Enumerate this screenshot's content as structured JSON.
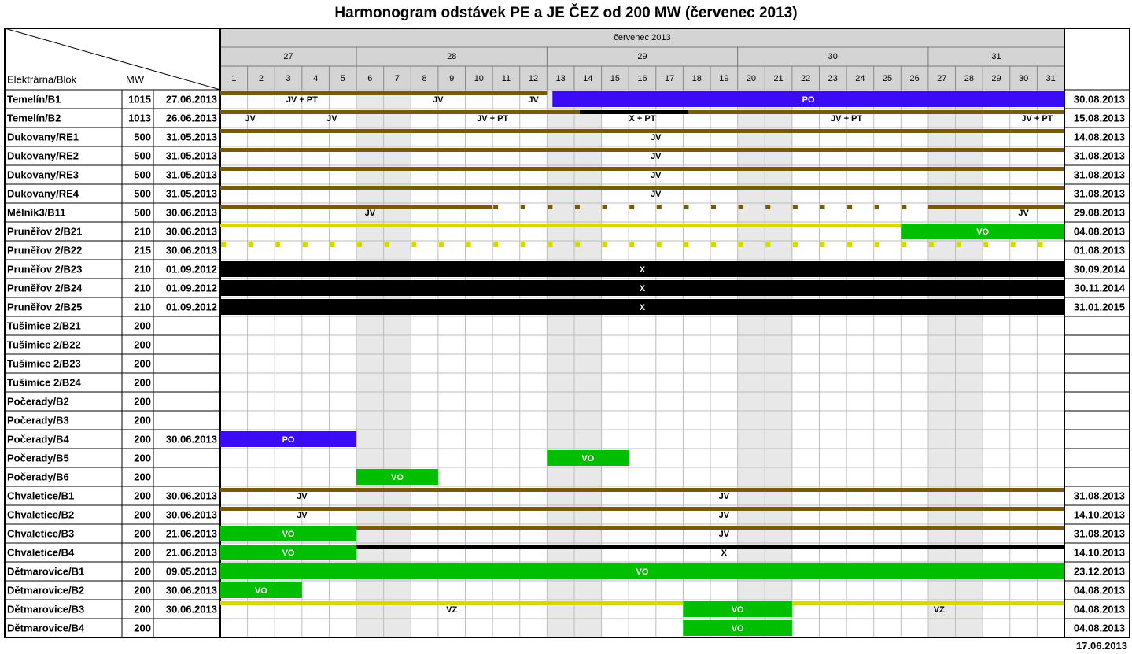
{
  "title": "Harmonogram odstávek PE a JE ČEZ od 200 MW (červenec 2013)",
  "footer_date": "17.06.2013",
  "colors": {
    "JV": "#7a5a0a",
    "PO": "#3b0bf6",
    "VO": "#00bf00",
    "X": "#000000",
    "VZ": "#d8d800",
    "weekend": "#e8e8e8",
    "header": "#d4d4d4"
  },
  "chart_data": {
    "type": "table",
    "header": {
      "col_plant": "Elektrárna/Blok",
      "col_mw": "MW",
      "month": "červenec 2013",
      "weeks": [
        {
          "label": "27",
          "from": 1,
          "to": 7
        },
        {
          "label": "28",
          "from": 8,
          "to": 14
        },
        {
          "label": "29",
          "from": 15,
          "to": 21
        },
        {
          "label": "30",
          "from": 22,
          "to": 28
        },
        {
          "label": "31",
          "from": 29,
          "to": 34
        }
      ],
      "days": [
        "1",
        "2",
        "3",
        "4",
        "5",
        "6",
        "7",
        "8",
        "9",
        "10",
        "11",
        "12",
        "13",
        "14",
        "15",
        "16",
        "17",
        "18",
        "19",
        "20",
        "21",
        "22",
        "23",
        "24",
        "25",
        "26",
        "27",
        "28",
        "29",
        "30",
        "31"
      ]
    },
    "weekend_days": [
      6,
      7,
      13,
      14,
      20,
      21,
      27,
      28
    ],
    "rows": [
      {
        "plant": "Temelín/B1",
        "mw": "1015",
        "start": "27.06.2013",
        "end": "30.08.2013",
        "bars": [
          {
            "type": "JV",
            "from": 1,
            "to": 13,
            "thin": true
          },
          {
            "type": "PO",
            "from": 13.2,
            "to": 32,
            "label": "PO"
          }
        ],
        "labels": [
          {
            "text": "JV + PT",
            "day": 3.5
          },
          {
            "text": "JV",
            "day": 8.5
          },
          {
            "text": "JV",
            "day": 12
          }
        ]
      },
      {
        "plant": "Temelín/B2",
        "mw": "1013",
        "start": "26.06.2013",
        "end": "15.08.2013",
        "bars": [
          {
            "type": "JV",
            "from": 1,
            "to": 14.2,
            "thin": true
          },
          {
            "type": "X",
            "from": 14.2,
            "to": 18.2,
            "thin": true
          },
          {
            "type": "JV",
            "from": 18.2,
            "to": 32,
            "thin": true
          }
        ],
        "labels": [
          {
            "text": "JV",
            "day": 1.6
          },
          {
            "text": "JV",
            "day": 4.6
          },
          {
            "text": "JV + PT",
            "day": 10.5
          },
          {
            "text": "X + PT",
            "day": 16
          },
          {
            "text": "JV + PT",
            "day": 23.5
          },
          {
            "text": "JV + PT",
            "day": 30.5
          }
        ]
      },
      {
        "plant": "Dukovany/RE1",
        "mw": "500",
        "start": "31.05.2013",
        "end": "14.08.2013",
        "bars": [
          {
            "type": "JV",
            "from": 1,
            "to": 32,
            "thin": true
          }
        ],
        "labels": [
          {
            "text": "JV",
            "day": 16.5
          }
        ]
      },
      {
        "plant": "Dukovany/RE2",
        "mw": "500",
        "start": "31.05.2013",
        "end": "31.08.2013",
        "bars": [
          {
            "type": "JV",
            "from": 1,
            "to": 32,
            "thin": true
          }
        ],
        "labels": [
          {
            "text": "JV",
            "day": 16.5
          }
        ]
      },
      {
        "plant": "Dukovany/RE3",
        "mw": "500",
        "start": "31.05.2013",
        "end": "31.08.2013",
        "bars": [
          {
            "type": "JV",
            "from": 1,
            "to": 32,
            "thin": true
          }
        ],
        "labels": [
          {
            "text": "JV",
            "day": 16.5
          }
        ]
      },
      {
        "plant": "Dukovany/RE4",
        "mw": "500",
        "start": "31.05.2013",
        "end": "31.08.2013",
        "bars": [
          {
            "type": "JV",
            "from": 1,
            "to": 32,
            "thin": true
          }
        ],
        "labels": [
          {
            "text": "JV",
            "day": 16.5
          }
        ]
      },
      {
        "plant": "Mělník3/B11",
        "mw": "500",
        "start": "30.06.2013",
        "end": "29.08.2013",
        "bars": [
          {
            "type": "JV",
            "from": 1,
            "to": 11,
            "thin": true
          },
          {
            "type": "JV",
            "from": 27,
            "to": 32,
            "thin": true
          }
        ],
        "dots": {
          "type": "JV",
          "from": 11,
          "to": 27
        },
        "labels": [
          {
            "text": "JV",
            "day": 6
          },
          {
            "text": "JV",
            "day": 30
          }
        ]
      },
      {
        "plant": "Pruněřov 2/B21",
        "mw": "210",
        "start": "30.06.2013",
        "end": "04.08.2013",
        "bars": [
          {
            "type": "VZ",
            "from": 1,
            "to": 26,
            "thin": true
          },
          {
            "type": "VO",
            "from": 26,
            "to": 32,
            "label": "VO"
          }
        ],
        "labels": []
      },
      {
        "plant": "Pruněřov 2/B22",
        "mw": "215",
        "start": "30.06.2013",
        "end": "01.08.2013",
        "bars": [],
        "dots": {
          "type": "VZ",
          "from": 1,
          "to": 32
        },
        "labels": []
      },
      {
        "plant": "Pruněřov 2/B23",
        "mw": "210",
        "start": "01.09.2012",
        "end": "30.09.2014",
        "bars": [
          {
            "type": "X",
            "from": 1,
            "to": 32,
            "label": "X"
          }
        ],
        "labels": []
      },
      {
        "plant": "Pruněřov 2/B24",
        "mw": "210",
        "start": "01.09.2012",
        "end": "30.11.2014",
        "bars": [
          {
            "type": "X",
            "from": 1,
            "to": 32,
            "label": "X"
          }
        ],
        "labels": []
      },
      {
        "plant": "Pruněřov 2/B25",
        "mw": "210",
        "start": "01.09.2012",
        "end": "31.01.2015",
        "bars": [
          {
            "type": "X",
            "from": 1,
            "to": 32,
            "label": "X"
          }
        ],
        "labels": []
      },
      {
        "plant": "Tušimice 2/B21",
        "mw": "200",
        "start": "",
        "end": "",
        "bars": [],
        "labels": []
      },
      {
        "plant": "Tušimice 2/B22",
        "mw": "200",
        "start": "",
        "end": "",
        "bars": [],
        "labels": []
      },
      {
        "plant": "Tušimice 2/B23",
        "mw": "200",
        "start": "",
        "end": "",
        "bars": [],
        "labels": []
      },
      {
        "plant": "Tušimice 2/B24",
        "mw": "200",
        "start": "",
        "end": "",
        "bars": [],
        "labels": []
      },
      {
        "plant": "Počerady/B2",
        "mw": "200",
        "start": "",
        "end": "",
        "bars": [],
        "labels": []
      },
      {
        "plant": "Počerady/B3",
        "mw": "200",
        "start": "",
        "end": "",
        "bars": [],
        "labels": []
      },
      {
        "plant": "Počerady/B4",
        "mw": "200",
        "start": "30.06.2013",
        "end": "",
        "bars": [
          {
            "type": "PO",
            "from": 1,
            "to": 6,
            "label": "PO"
          }
        ],
        "labels": []
      },
      {
        "plant": "Počerady/B5",
        "mw": "200",
        "start": "",
        "end": "",
        "bars": [
          {
            "type": "VO",
            "from": 13,
            "to": 16,
            "label": "VO"
          }
        ],
        "labels": []
      },
      {
        "plant": "Počerady/B6",
        "mw": "200",
        "start": "",
        "end": "",
        "bars": [
          {
            "type": "VO",
            "from": 6,
            "to": 9,
            "label": "VO"
          }
        ],
        "labels": []
      },
      {
        "plant": "Chvaletice/B1",
        "mw": "200",
        "start": "30.06.2013",
        "end": "31.08.2013",
        "bars": [
          {
            "type": "JV",
            "from": 1,
            "to": 32,
            "thin": true
          }
        ],
        "labels": [
          {
            "text": "JV",
            "day": 3.5
          },
          {
            "text": "JV",
            "day": 19
          }
        ]
      },
      {
        "plant": "Chvaletice/B2",
        "mw": "200",
        "start": "30.06.2013",
        "end": "14.10.2013",
        "bars": [
          {
            "type": "JV",
            "from": 1,
            "to": 32,
            "thin": true
          }
        ],
        "labels": [
          {
            "text": "JV",
            "day": 3.5
          },
          {
            "text": "JV",
            "day": 19
          }
        ]
      },
      {
        "plant": "Chvaletice/B3",
        "mw": "200",
        "start": "21.06.2013",
        "end": "31.08.2013",
        "bars": [
          {
            "type": "VO",
            "from": 1,
            "to": 6,
            "label": "VO"
          },
          {
            "type": "JV",
            "from": 6,
            "to": 32,
            "thin": true
          }
        ],
        "labels": [
          {
            "text": "JV",
            "day": 19
          }
        ]
      },
      {
        "plant": "Chvaletice/B4",
        "mw": "200",
        "start": "21.06.2013",
        "end": "14.10.2013",
        "bars": [
          {
            "type": "VO",
            "from": 1,
            "to": 6,
            "label": "VO"
          },
          {
            "type": "X",
            "from": 6,
            "to": 32,
            "thin": true
          }
        ],
        "labels": [
          {
            "text": "X",
            "day": 19
          }
        ]
      },
      {
        "plant": "Dětmarovice/B1",
        "mw": "200",
        "start": "09.05.2013",
        "end": "23.12.2013",
        "bars": [
          {
            "type": "VO",
            "from": 1,
            "to": 32,
            "label": "VO"
          }
        ],
        "labels": []
      },
      {
        "plant": "Dětmarovice/B2",
        "mw": "200",
        "start": "30.06.2013",
        "end": "04.08.2013",
        "bars": [
          {
            "type": "VO",
            "from": 1,
            "to": 4,
            "label": "VO"
          }
        ],
        "labels": []
      },
      {
        "plant": "Dětmarovice/B3",
        "mw": "200",
        "start": "30.06.2013",
        "end": "04.08.2013",
        "bars": [
          {
            "type": "VZ",
            "from": 1,
            "to": 18,
            "thin": true
          },
          {
            "type": "VO",
            "from": 18,
            "to": 22,
            "label": "VO"
          },
          {
            "type": "VZ",
            "from": 22,
            "to": 32,
            "thin": true
          }
        ],
        "labels": [
          {
            "text": "VZ",
            "day": 9
          },
          {
            "text": "VZ",
            "day": 26.9
          }
        ]
      },
      {
        "plant": "Dětmarovice/B4",
        "mw": "200",
        "start": "",
        "end": "04.08.2013",
        "bars": [
          {
            "type": "VO",
            "from": 18,
            "to": 22,
            "label": "VO"
          }
        ],
        "labels": []
      }
    ]
  }
}
